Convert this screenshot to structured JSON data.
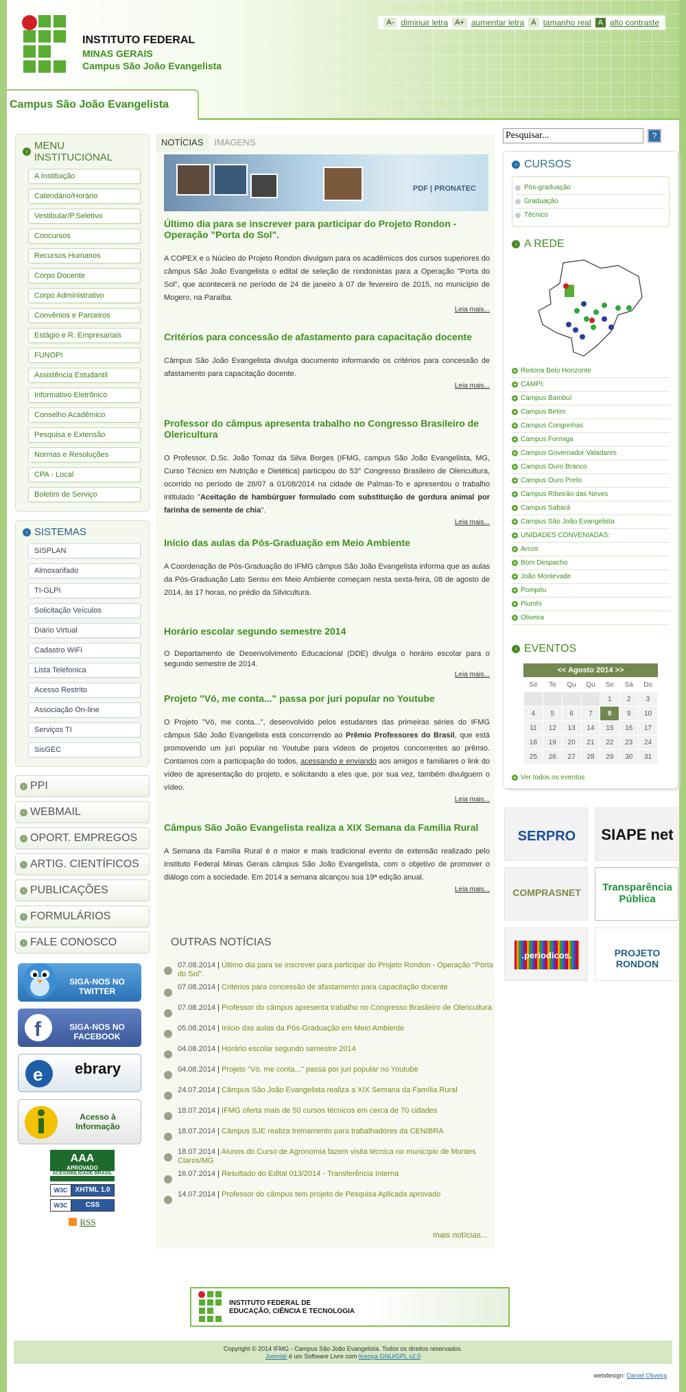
{
  "header": {
    "inst_line1": "INSTITUTO FEDERAL",
    "inst_line2": "MINAS GERAIS",
    "inst_line3": "Campus São João Evangelista",
    "campus_tab": "Campus São João Evangelista",
    "access": [
      {
        "key": "A-",
        "label": "diminuir letra"
      },
      {
        "key": "A+",
        "label": "aumentar letra"
      },
      {
        "key": "A",
        "label": "tamanho real"
      },
      {
        "key": "A",
        "label": "alto contraste"
      }
    ]
  },
  "menu_institucional": {
    "title": "MENU INSTITUCIONAL",
    "items": [
      "A Instituição",
      "Calendário/Horário",
      "Vestibular/P.Seletivo",
      "Concursos",
      "Recursos Humanos",
      "Corpo Docente",
      "Corpo Administrativo",
      "Convênios e Parceiros",
      "Estágio e R. Empresariais",
      "FUNOPI",
      "Assistência Estudantil",
      "Informativo Eletrônico",
      "Conselho Acadêmico",
      "Pesquisa e Extensão",
      "Normas e Resoluções",
      "CPA - Local",
      "Boletim de Serviço"
    ]
  },
  "sistemas": {
    "title": "SISTEMAS",
    "items": [
      "SISPLAN",
      "Almoxarifado",
      "TI-GLPI",
      "Solicitação Veículos",
      "Diário Virtual",
      "Cadastro WiFi",
      "Lista Telefonica",
      "Acesso Restrito",
      "Associação On-line",
      "Serviços TI",
      "SisGEC"
    ]
  },
  "big_links": [
    "PPI",
    "WEBMAIL",
    "OPORT. EMPREGOS",
    "ARTIG. CIENTÍFICOS",
    "PUBLICAÇÕES",
    "FORMULÁRIOS",
    "FALE CONOSCO"
  ],
  "social": {
    "twitter": "SIGA-NOS NO TWITTER",
    "facebook": "SIGA-NOS NO FACEBOOK",
    "ebrary": "ebrary",
    "acesso": "Acesso à Informação"
  },
  "badges": {
    "aaa": "AAA",
    "aaa_sub": "APROVADO",
    "aaa_org": "ACESSIBILIDADE BRASIL",
    "xhtml": "XHTML 1.0",
    "css": "CSS",
    "w3c": "W3C",
    "rss": "RSS"
  },
  "center": {
    "tabs": [
      "NOTÍCIAS",
      "IMAGENS"
    ],
    "banner_text": "PDF | PRONATEC",
    "read_more": "Leia mais...",
    "news": [
      {
        "title": "Último dia para se inscrever para participar do Projeto Rondon - Operação \"Porta do Sol\".",
        "body": "A COPEX e o Núcleo do Projeto Rondon divulgam para os acadêmicos dos cursos superiores do câmpus São João Evangelista o edital de seleção de rondonistas para a Operação \"Porta do Sol\", que acontecerá no período de 24 de janeiro à 07 de fevereiro de 2015, no município de Mogero, na Paraíba."
      },
      {
        "title": "Critérios para concessão de afastamento para capacitação docente",
        "body": "Câmpus São João Evangelista divulga documento informando os critérios para concessão de afastamento para capacitação docente."
      },
      {
        "title": "Professor do câmpus apresenta trabalho no Congresso Brasileiro de Olericultura",
        "body": "O Professor, D.Sc. João Tomaz da Silva Borges (IFMG, campus São João Evangelista, MG, Curso Técnico em Nutrição e Dietética) participou do 53° Congresso Brasileiro de Olericultura, ocorrido no período de 28/07 a 01/08/2014 na cidade de Palmas-To e apresentou o trabalho intitulado \"",
        "bold": "Aceitação de hambúrguer formulado com substituição de gordura animal por farinha de semente de chia",
        "tail": "\"."
      },
      {
        "title": "Início das aulas da Pós-Graduação em Meio Ambiente",
        "body": "A Coordenação de Pós-Graduação do IFMG câmpus São João Evangelista informa que as aulas da Pós-Graduação Lato Sensu em Meio Ambiente começam nesta sexta-feira, 08 de agosto de 2014, às 17 horas, no prédio da Silvicultura."
      },
      {
        "title": "Horário escolar segundo semestre 2014",
        "body": "O Departamento de Desenvolvimento Educacional (DDE) divulga o horário escolar para o segundo semestre de 2014."
      },
      {
        "title": "Projeto \"Vó, me conta...\" passa por juri popular no Youtube",
        "body": "O Projeto \"Vó, me conta...\", desenvolvido pelos estudantes das primeiras séries do IFMG câmpus São João Evangelista está concorrendo ao ",
        "bold": "Prêmio Professores do Brasil",
        "tail": ", que está promovendo um juri popular no Youtube para vídeos de projetos concorrentes ao prêmio. Contamos com a participação do todos, ",
        "link": "acessando e enviando",
        "tail2": " aos amigos e familiares o link do vídeo de apresentação do projeto, e solicitando a eles que, por sua vez, também divulguem o vídeo."
      },
      {
        "title": "Câmpus São João Evangelista realiza a XIX Semana da Família Rural",
        "body": "A Semana da Família Rural é o maior e mais tradicional evento de extensão realizado pelo Instituto Federal Minas Gerais câmpus São João Evangelista, com o objetivo de promover o diálogo com a sociedade. Em 2014 a semana alcançou sua 19ª edição anual."
      }
    ],
    "other_title": "OUTRAS NOTÍCIAS",
    "other": [
      {
        "date": "07.08.2014",
        "title": "Último dia para se inscrever para participar do Projeto Rondon - Operação \"Porta do Sol\"."
      },
      {
        "date": "07.08.2014",
        "title": "Critérios para concessão de afastamento para capacitação docente"
      },
      {
        "date": "07.08.2014",
        "title": "Professor do câmpus apresenta trabalho no Congresso Brasileiro de Olericultura"
      },
      {
        "date": "05.08.2014",
        "title": "Início das aulas da Pós-Graduação em Meio Ambiente"
      },
      {
        "date": "04.08.2014",
        "title": "Horário escolar segundo semestre 2014"
      },
      {
        "date": "04.08.2014",
        "title": "Projeto \"Vó, me conta...\" passa por juri popular no Youtube"
      },
      {
        "date": "24.07.2014",
        "title": "Câmpus São João Evangelista realiza a XIX Semana da Família Rural"
      },
      {
        "date": "18.07.2014",
        "title": "IFMG oferta mais de 50 cursos técnicos em cerca de 70 cidades"
      },
      {
        "date": "18.07.2014",
        "title": "Câmpus SJE realiza treinamento para trabalhadores da CENIBRA"
      },
      {
        "date": "18.07.2014",
        "title": "Alunos do Curso de Agronomia fazem visita técnica no município de Montes Claros/MG"
      },
      {
        "date": "16.07.2014",
        "title": "Resultado do Edital 013/2014 - Transferência Interna"
      },
      {
        "date": "14.07.2014",
        "title": "Professor do câmpus tem projeto de Pesquisa Aplicada aprovado"
      }
    ],
    "more_news": "mais notícias..."
  },
  "right": {
    "search_value": "Pesquisar...",
    "search_button": "?",
    "cursos_title": "CURSOS",
    "cursos": [
      "Pós-graduação",
      "Graduação",
      "Técnico"
    ],
    "rede_title": "A REDE",
    "rede": [
      "Reitoria Belo Horizonte",
      "CAMPI:",
      "Campus Bambuí",
      "Campus Betim",
      "Campus Congonhas",
      "Campus Formiga",
      "Campus Governador Valadares",
      "Campus Ouro Branco",
      "Campus Ouro Preto",
      "Campus Ribeirão das Neves",
      "Campus Sabará",
      "Campus São João Evangelista",
      "UNIDADES CONVENIADAS:",
      "Arcos",
      "Bom Despacho",
      "João Monlevade",
      "Pompéu",
      "Piumhi",
      "Oliveira"
    ],
    "eventos_title": "EVENTOS",
    "calendar": {
      "header": "<<  Agosto 2014  >>",
      "weekdays": [
        "Se",
        "Te",
        "Qu",
        "Qu",
        "Se",
        "Sá",
        "Do"
      ],
      "weeks": [
        [
          "",
          "",
          "",
          "",
          "1",
          "2",
          "3"
        ],
        [
          "4",
          "5",
          "6",
          "7",
          "8",
          "9",
          "10"
        ],
        [
          "11",
          "12",
          "13",
          "14",
          "15",
          "16",
          "17"
        ],
        [
          "18",
          "19",
          "20",
          "21",
          "22",
          "23",
          "24"
        ],
        [
          "25",
          "26",
          "27",
          "28",
          "29",
          "30",
          "31"
        ]
      ],
      "today": "8"
    },
    "ver_todos": "Ver todos os eventos"
  },
  "partners": [
    "SERPRO",
    "SIAPE net",
    "COMPRASNET",
    "Transparência Pública",
    ".periodicos.",
    "PROJETO RONDON"
  ],
  "footer": {
    "logo_line1": "INSTITUTO FEDERAL DE",
    "logo_line2": "EDUCAÇÃO, CIÊNCIA E TECNOLOGIA",
    "copyright": "Copyright © 2014 IFMG - Campus São João Evangelista. Todos os direitos reservados.",
    "joomla": "Joomla!",
    "software": " é um Software Livre com ",
    "license": "licença GNU/GPL v2.0",
    "webdesign_label": "webdesign:",
    "webdesign_name": "Daniel Oliveira"
  }
}
